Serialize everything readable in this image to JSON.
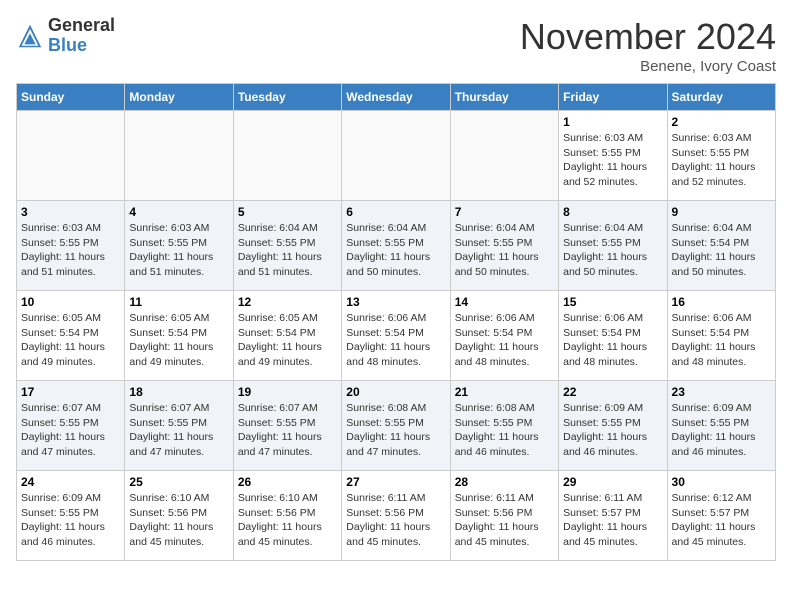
{
  "header": {
    "logo_general": "General",
    "logo_blue": "Blue",
    "month_title": "November 2024",
    "location": "Benene, Ivory Coast"
  },
  "days_of_week": [
    "Sunday",
    "Monday",
    "Tuesday",
    "Wednesday",
    "Thursday",
    "Friday",
    "Saturday"
  ],
  "weeks": [
    [
      null,
      null,
      null,
      null,
      null,
      {
        "day": "1",
        "sunrise": "Sunrise: 6:03 AM",
        "sunset": "Sunset: 5:55 PM",
        "daylight": "Daylight: 11 hours and 52 minutes."
      },
      {
        "day": "2",
        "sunrise": "Sunrise: 6:03 AM",
        "sunset": "Sunset: 5:55 PM",
        "daylight": "Daylight: 11 hours and 52 minutes."
      }
    ],
    [
      {
        "day": "3",
        "sunrise": "Sunrise: 6:03 AM",
        "sunset": "Sunset: 5:55 PM",
        "daylight": "Daylight: 11 hours and 51 minutes."
      },
      {
        "day": "4",
        "sunrise": "Sunrise: 6:03 AM",
        "sunset": "Sunset: 5:55 PM",
        "daylight": "Daylight: 11 hours and 51 minutes."
      },
      {
        "day": "5",
        "sunrise": "Sunrise: 6:04 AM",
        "sunset": "Sunset: 5:55 PM",
        "daylight": "Daylight: 11 hours and 51 minutes."
      },
      {
        "day": "6",
        "sunrise": "Sunrise: 6:04 AM",
        "sunset": "Sunset: 5:55 PM",
        "daylight": "Daylight: 11 hours and 50 minutes."
      },
      {
        "day": "7",
        "sunrise": "Sunrise: 6:04 AM",
        "sunset": "Sunset: 5:55 PM",
        "daylight": "Daylight: 11 hours and 50 minutes."
      },
      {
        "day": "8",
        "sunrise": "Sunrise: 6:04 AM",
        "sunset": "Sunset: 5:55 PM",
        "daylight": "Daylight: 11 hours and 50 minutes."
      },
      {
        "day": "9",
        "sunrise": "Sunrise: 6:04 AM",
        "sunset": "Sunset: 5:54 PM",
        "daylight": "Daylight: 11 hours and 50 minutes."
      }
    ],
    [
      {
        "day": "10",
        "sunrise": "Sunrise: 6:05 AM",
        "sunset": "Sunset: 5:54 PM",
        "daylight": "Daylight: 11 hours and 49 minutes."
      },
      {
        "day": "11",
        "sunrise": "Sunrise: 6:05 AM",
        "sunset": "Sunset: 5:54 PM",
        "daylight": "Daylight: 11 hours and 49 minutes."
      },
      {
        "day": "12",
        "sunrise": "Sunrise: 6:05 AM",
        "sunset": "Sunset: 5:54 PM",
        "daylight": "Daylight: 11 hours and 49 minutes."
      },
      {
        "day": "13",
        "sunrise": "Sunrise: 6:06 AM",
        "sunset": "Sunset: 5:54 PM",
        "daylight": "Daylight: 11 hours and 48 minutes."
      },
      {
        "day": "14",
        "sunrise": "Sunrise: 6:06 AM",
        "sunset": "Sunset: 5:54 PM",
        "daylight": "Daylight: 11 hours and 48 minutes."
      },
      {
        "day": "15",
        "sunrise": "Sunrise: 6:06 AM",
        "sunset": "Sunset: 5:54 PM",
        "daylight": "Daylight: 11 hours and 48 minutes."
      },
      {
        "day": "16",
        "sunrise": "Sunrise: 6:06 AM",
        "sunset": "Sunset: 5:54 PM",
        "daylight": "Daylight: 11 hours and 48 minutes."
      }
    ],
    [
      {
        "day": "17",
        "sunrise": "Sunrise: 6:07 AM",
        "sunset": "Sunset: 5:55 PM",
        "daylight": "Daylight: 11 hours and 47 minutes."
      },
      {
        "day": "18",
        "sunrise": "Sunrise: 6:07 AM",
        "sunset": "Sunset: 5:55 PM",
        "daylight": "Daylight: 11 hours and 47 minutes."
      },
      {
        "day": "19",
        "sunrise": "Sunrise: 6:07 AM",
        "sunset": "Sunset: 5:55 PM",
        "daylight": "Daylight: 11 hours and 47 minutes."
      },
      {
        "day": "20",
        "sunrise": "Sunrise: 6:08 AM",
        "sunset": "Sunset: 5:55 PM",
        "daylight": "Daylight: 11 hours and 47 minutes."
      },
      {
        "day": "21",
        "sunrise": "Sunrise: 6:08 AM",
        "sunset": "Sunset: 5:55 PM",
        "daylight": "Daylight: 11 hours and 46 minutes."
      },
      {
        "day": "22",
        "sunrise": "Sunrise: 6:09 AM",
        "sunset": "Sunset: 5:55 PM",
        "daylight": "Daylight: 11 hours and 46 minutes."
      },
      {
        "day": "23",
        "sunrise": "Sunrise: 6:09 AM",
        "sunset": "Sunset: 5:55 PM",
        "daylight": "Daylight: 11 hours and 46 minutes."
      }
    ],
    [
      {
        "day": "24",
        "sunrise": "Sunrise: 6:09 AM",
        "sunset": "Sunset: 5:55 PM",
        "daylight": "Daylight: 11 hours and 46 minutes."
      },
      {
        "day": "25",
        "sunrise": "Sunrise: 6:10 AM",
        "sunset": "Sunset: 5:56 PM",
        "daylight": "Daylight: 11 hours and 45 minutes."
      },
      {
        "day": "26",
        "sunrise": "Sunrise: 6:10 AM",
        "sunset": "Sunset: 5:56 PM",
        "daylight": "Daylight: 11 hours and 45 minutes."
      },
      {
        "day": "27",
        "sunrise": "Sunrise: 6:11 AM",
        "sunset": "Sunset: 5:56 PM",
        "daylight": "Daylight: 11 hours and 45 minutes."
      },
      {
        "day": "28",
        "sunrise": "Sunrise: 6:11 AM",
        "sunset": "Sunset: 5:56 PM",
        "daylight": "Daylight: 11 hours and 45 minutes."
      },
      {
        "day": "29",
        "sunrise": "Sunrise: 6:11 AM",
        "sunset": "Sunset: 5:57 PM",
        "daylight": "Daylight: 11 hours and 45 minutes."
      },
      {
        "day": "30",
        "sunrise": "Sunrise: 6:12 AM",
        "sunset": "Sunset: 5:57 PM",
        "daylight": "Daylight: 11 hours and 45 minutes."
      }
    ]
  ]
}
